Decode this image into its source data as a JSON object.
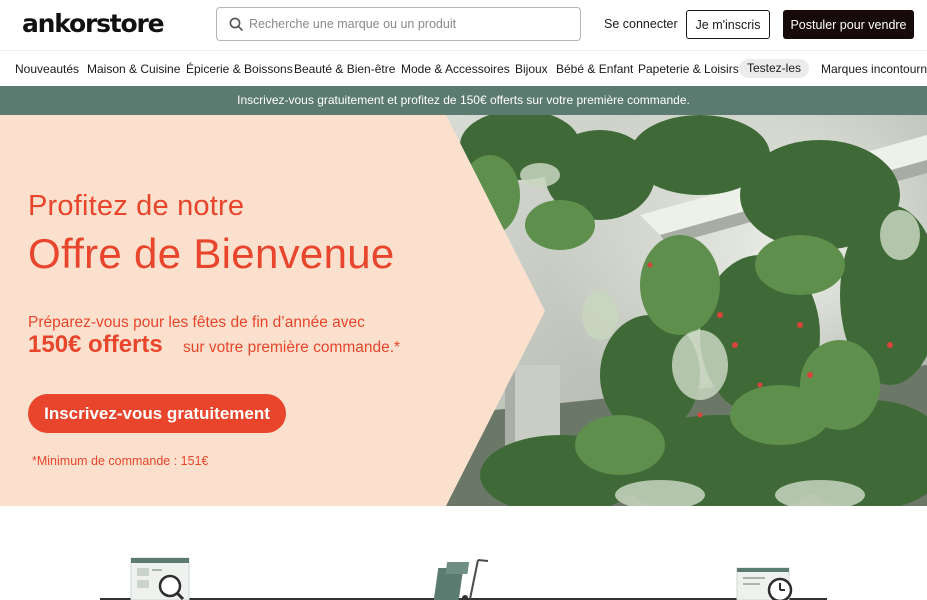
{
  "header": {
    "logo": "ankorstore",
    "search_placeholder": "Recherche une marque ou un produit",
    "login_label": "Se connecter",
    "signup_label": "Je m'inscris",
    "sell_label": "Postuler pour vendre"
  },
  "nav": {
    "items": [
      "Nouveautés",
      "Maison & Cuisine",
      "Épicerie & Boissons",
      "Beauté & Bien-être",
      "Mode & Accessoires",
      "Bijoux",
      "Bébé & Enfant",
      "Papeterie & Loisirs",
      "Testez-les",
      "Marques incontournables"
    ]
  },
  "banner": {
    "text": "Inscrivez-vous gratuitement et profitez de 150€ offerts sur votre première commande."
  },
  "hero": {
    "line1": "Profitez de notre",
    "line2": "Offre de Bienvenue",
    "prep": "Préparez-vous pour les fêtes de fin d’année avec",
    "amount": "150€ offerts",
    "amount_sub": "sur votre première commande.*",
    "cta_label": "Inscrivez-vous gratuitement",
    "minimum": "*Minimum de commande : 151€"
  },
  "colors": {
    "accent": "#e8452c",
    "hero_bg": "#fbe1cd",
    "banner_bg": "#5b7a70",
    "dark_button": "#160a0a"
  },
  "icons": [
    "search-icon",
    "catalog-search-icon",
    "hand-truck-icon",
    "clock-document-icon"
  ]
}
